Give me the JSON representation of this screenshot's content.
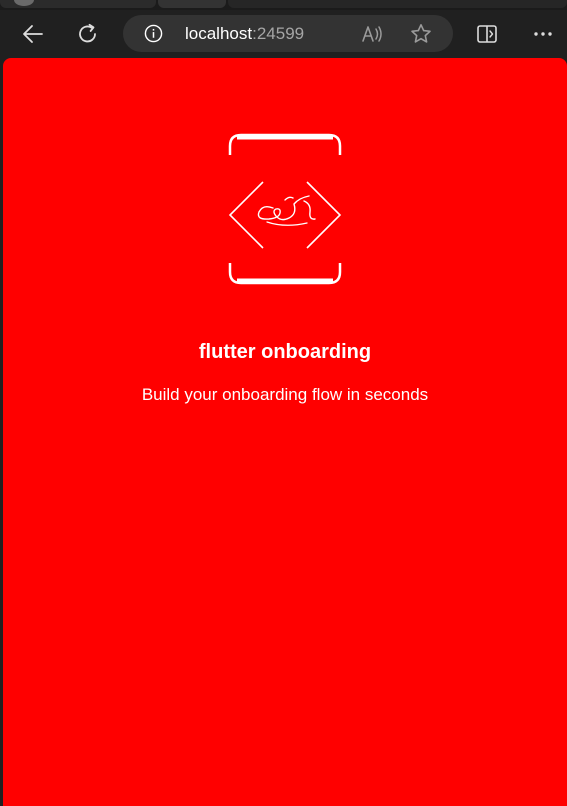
{
  "browser": {
    "address_host": "localhost",
    "address_port": ":24599",
    "icons": {
      "back": "back-arrow-icon",
      "reload": "reload-icon",
      "site_info": "info-icon",
      "read_aloud": "read-aloud-icon",
      "favorite": "star-icon",
      "split_screen": "split-screen-icon",
      "more": "more-icon"
    }
  },
  "page": {
    "background_color": "#ff0000",
    "title": "flutter onboarding",
    "subtitle": "Build your onboarding flow in seconds",
    "logo_icon": "code-brackets-logo-icon"
  }
}
